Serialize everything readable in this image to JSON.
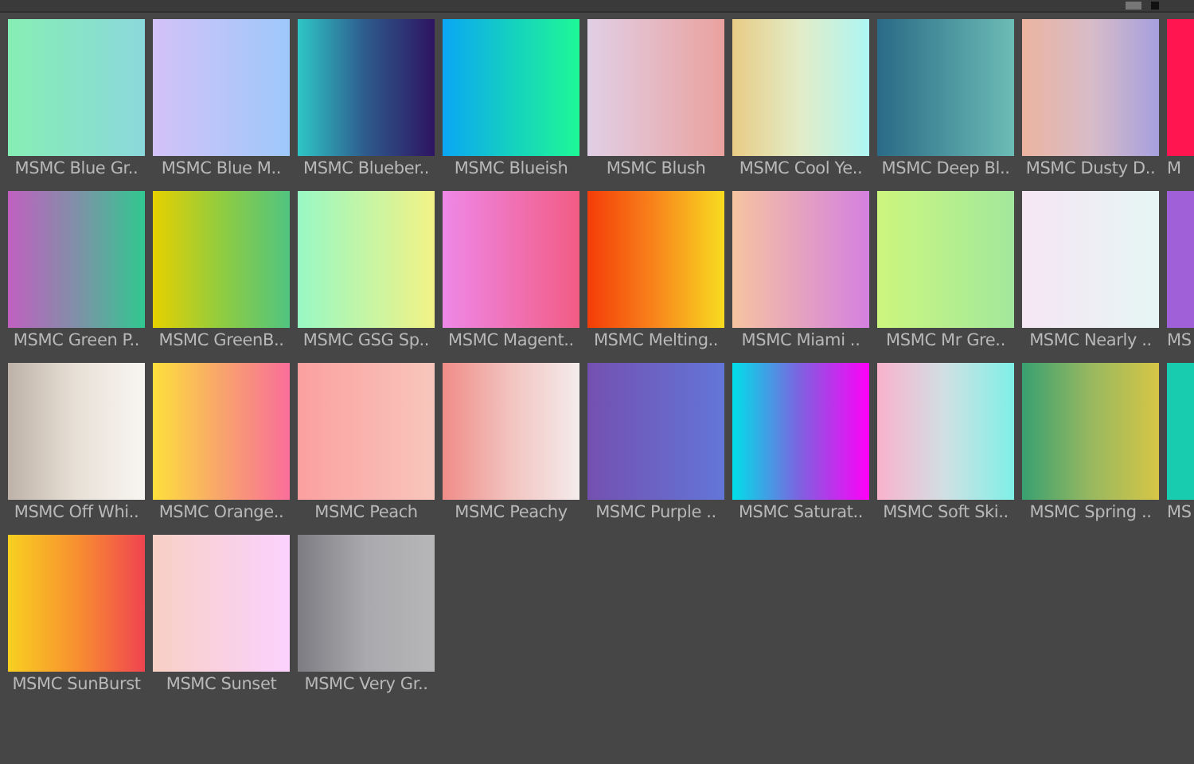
{
  "swatches": [
    {
      "label": "MSMC Blue Gr..",
      "stops": [
        {
          "color": "#86eeb4"
        },
        {
          "color": "#8bd8dc"
        }
      ]
    },
    {
      "label": "MSMC Blue M..",
      "stops": [
        {
          "color": "#d3c2f8"
        },
        {
          "color": "#9ec8fa"
        }
      ]
    },
    {
      "label": "MSMC Blueber..",
      "stops": [
        {
          "color": "#2ec6c6"
        },
        {
          "color": "#2e5a8c"
        },
        {
          "color": "#2e1462"
        }
      ]
    },
    {
      "label": "MSMC Blueish",
      "stops": [
        {
          "color": "#0aa6f4"
        },
        {
          "color": "#15d0c0"
        },
        {
          "color": "#1ef896"
        }
      ]
    },
    {
      "label": "MSMC Blush",
      "stops": [
        {
          "color": "#e0cfe6"
        },
        {
          "color": "#eaa29e"
        }
      ]
    },
    {
      "label": "MSMC Cool Ye..",
      "stops": [
        {
          "color": "#e8cc86"
        },
        {
          "color": "#e2ecc8"
        },
        {
          "color": "#aef6f4"
        }
      ]
    },
    {
      "label": "MSMC Deep Bl..",
      "stops": [
        {
          "color": "#2a6a86"
        },
        {
          "color": "#6cbcb6"
        }
      ]
    },
    {
      "label": "MSMC Dusty D..",
      "stops": [
        {
          "color": "#ecb4a0"
        },
        {
          "color": "#d8bcc8"
        },
        {
          "color": "#a6a0de"
        }
      ]
    },
    {
      "label": "M",
      "stops": [
        {
          "color": "#ff1650"
        }
      ]
    },
    {
      "label": "MSMC Green P..",
      "stops": [
        {
          "color": "#c060c0"
        },
        {
          "color": "#8090a8"
        },
        {
          "color": "#30c890"
        }
      ]
    },
    {
      "label": "MSMC GreenB..",
      "stops": [
        {
          "color": "#e6d000"
        },
        {
          "color": "#90cc40"
        },
        {
          "color": "#50c480"
        }
      ]
    },
    {
      "label": "MSMC GSG Sp..",
      "stops": [
        {
          "color": "#98f8c4"
        },
        {
          "color": "#f2f286"
        }
      ]
    },
    {
      "label": "MSMC Magent..",
      "stops": [
        {
          "color": "#ee88e8"
        },
        {
          "color": "#f25c84"
        }
      ]
    },
    {
      "label": "MSMC Melting..",
      "stops": [
        {
          "color": "#f43c08"
        },
        {
          "color": "#f8861c"
        },
        {
          "color": "#f8dc20"
        }
      ]
    },
    {
      "label": "MSMC Miami ..",
      "stops": [
        {
          "color": "#f6c4a0"
        },
        {
          "color": "#d480e0"
        }
      ]
    },
    {
      "label": "MSMC Mr Gre..",
      "stops": [
        {
          "color": "#ccf67e"
        },
        {
          "color": "#a2e89c"
        }
      ]
    },
    {
      "label": "MSMC Nearly ..",
      "stops": [
        {
          "color": "#f6e6f4"
        },
        {
          "color": "#e6f6f4"
        }
      ]
    },
    {
      "label": "MS",
      "stops": [
        {
          "color": "#a060d8"
        }
      ]
    },
    {
      "label": "MSMC Off Whi..",
      "stops": [
        {
          "color": "#beb2a8"
        },
        {
          "color": "#e8e0d6"
        },
        {
          "color": "#f8f6f2"
        }
      ]
    },
    {
      "label": "MSMC Orange..",
      "stops": [
        {
          "color": "#fee03c"
        },
        {
          "color": "#f8a46c"
        },
        {
          "color": "#fa6e9a"
        }
      ]
    },
    {
      "label": "MSMC Peach",
      "stops": [
        {
          "color": "#fba0a0"
        },
        {
          "color": "#f8c6bc"
        }
      ]
    },
    {
      "label": "MSMC Peachy",
      "stops": [
        {
          "color": "#f08c88"
        },
        {
          "color": "#f2c4c0"
        },
        {
          "color": "#f4ecec"
        }
      ]
    },
    {
      "label": "MSMC Purple ..",
      "stops": [
        {
          "color": "#7450b0"
        },
        {
          "color": "#6276d8"
        }
      ]
    },
    {
      "label": "MSMC Saturat..",
      "stops": [
        {
          "color": "#00e0e8"
        },
        {
          "color": "#8060e0"
        },
        {
          "color": "#ff00f8"
        }
      ]
    },
    {
      "label": "MSMC Soft Ski..",
      "stops": [
        {
          "color": "#fab2cc"
        },
        {
          "color": "#d0e0e4"
        },
        {
          "color": "#7ef0e6"
        }
      ]
    },
    {
      "label": "MSMC Spring ..",
      "stops": [
        {
          "color": "#38a070"
        },
        {
          "color": "#98b860"
        },
        {
          "color": "#d6c646"
        }
      ]
    },
    {
      "label": "MS",
      "stops": [
        {
          "color": "#18ccb0"
        }
      ]
    },
    {
      "label": "MSMC SunBurst",
      "stops": [
        {
          "color": "#f8d020"
        },
        {
          "color": "#f89030"
        },
        {
          "color": "#f04450"
        }
      ]
    },
    {
      "label": "MSMC Sunset",
      "stops": [
        {
          "color": "#f8d0c4"
        },
        {
          "color": "#fbd2fe"
        }
      ]
    },
    {
      "label": "MSMC Very Gr..",
      "stops": [
        {
          "color": "#7c7c82"
        },
        {
          "color": "#aaaaae"
        },
        {
          "color": "#b6b6b8"
        }
      ]
    }
  ]
}
